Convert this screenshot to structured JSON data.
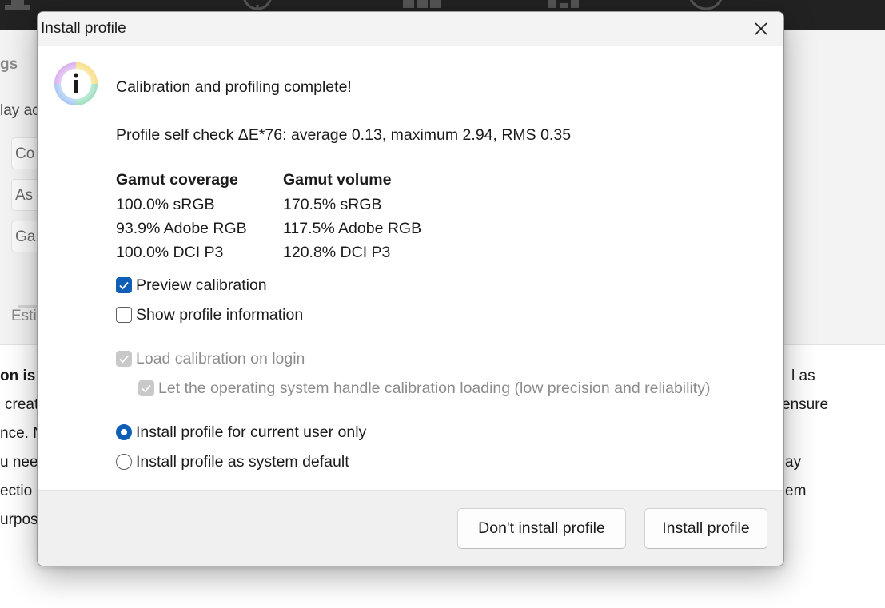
{
  "background": {
    "side_labels": [
      "gs",
      "lay ac",
      "Co",
      "As",
      "Ga",
      "Esti"
    ],
    "left_fragments": [
      "on is o",
      "creat",
      "nce. N",
      "u nee",
      "ectio",
      "urpos"
    ],
    "right_fragments": [
      "l as",
      "ensure",
      "ay",
      "em"
    ]
  },
  "dialog": {
    "title": "Install profile",
    "message": "Calibration and profiling complete!",
    "self_check": "Profile self check ΔE*76: average 0.13, maximum 2.94, RMS 0.35",
    "gamut": {
      "coverage_header": "Gamut coverage",
      "volume_header": "Gamut volume",
      "coverage": [
        "100.0% sRGB",
        "93.9% Adobe RGB",
        "100.0% DCI P3"
      ],
      "volume": [
        "170.5% sRGB",
        "117.5% Adobe RGB",
        "120.8% DCI P3"
      ]
    },
    "options": {
      "preview_calibration": "Preview calibration",
      "show_profile_info": "Show profile information",
      "load_on_login": "Load calibration on login",
      "os_handle_loading": "Let the operating system handle calibration loading (low precision and reliability)",
      "install_current_user": "Install profile for current user only",
      "install_system_default": "Install profile as system default"
    },
    "buttons": {
      "dont_install": "Don't install profile",
      "install": "Install profile"
    },
    "colors": {
      "accent": "#0f5fb7",
      "disabled_text": "#8c8c8c",
      "footer_bg": "#f0f0f0"
    }
  }
}
